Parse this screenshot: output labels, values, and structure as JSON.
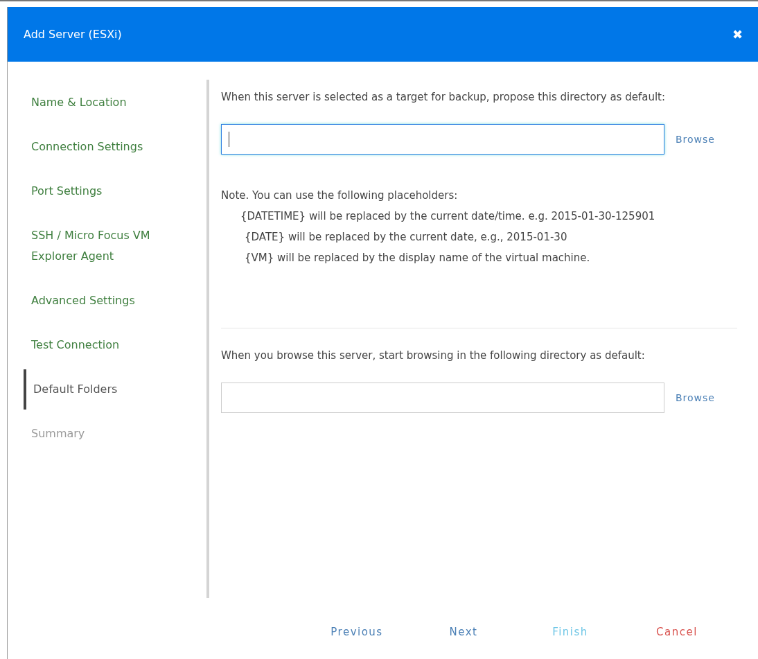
{
  "dialog": {
    "title": "Add Server (ESXi)",
    "close": "✖"
  },
  "steps": [
    {
      "label": "Name & Location",
      "completed": true,
      "selected": false
    },
    {
      "label": "Connection Settings",
      "completed": true,
      "selected": false
    },
    {
      "label": "Port Settings",
      "completed": true,
      "selected": false
    },
    {
      "label": "SSH / Micro Focus VM Explorer Agent",
      "completed": true,
      "selected": false
    },
    {
      "label": "Advanced Settings",
      "completed": true,
      "selected": false
    },
    {
      "label": "Test Connection",
      "completed": true,
      "selected": false
    },
    {
      "label": "Default Folders",
      "completed": false,
      "selected": true
    },
    {
      "label": "Summary",
      "completed": false,
      "selected": false
    }
  ],
  "sections": [
    {
      "prompt": "When this server is selected as a target for backup, propose this directory as default:",
      "focused": true,
      "browse": "Browse",
      "note": {
        "heading": "Note. You can use the following placeholders:",
        "lines": [
          "{DATETIME} will be replaced by the current date/time. e.g. 2015-01-30-125901",
          "{DATE} will be replaced by the current date, e.g., 2015-01-30",
          "{VM} will be replaced by the display name of the virtual machine."
        ]
      }
    },
    {
      "prompt": "When you browse this server, start browsing in the following directory as default:",
      "focused": false,
      "browse": "Browse"
    }
  ],
  "buttons": [
    {
      "label": "Previous",
      "kind": "nav",
      "disabled": false
    },
    {
      "label": "Next",
      "kind": "nav",
      "disabled": false
    },
    {
      "label": "Finish",
      "kind": "nav",
      "disabled": true
    },
    {
      "label": "Cancel",
      "kind": "cancel",
      "disabled": false
    }
  ]
}
